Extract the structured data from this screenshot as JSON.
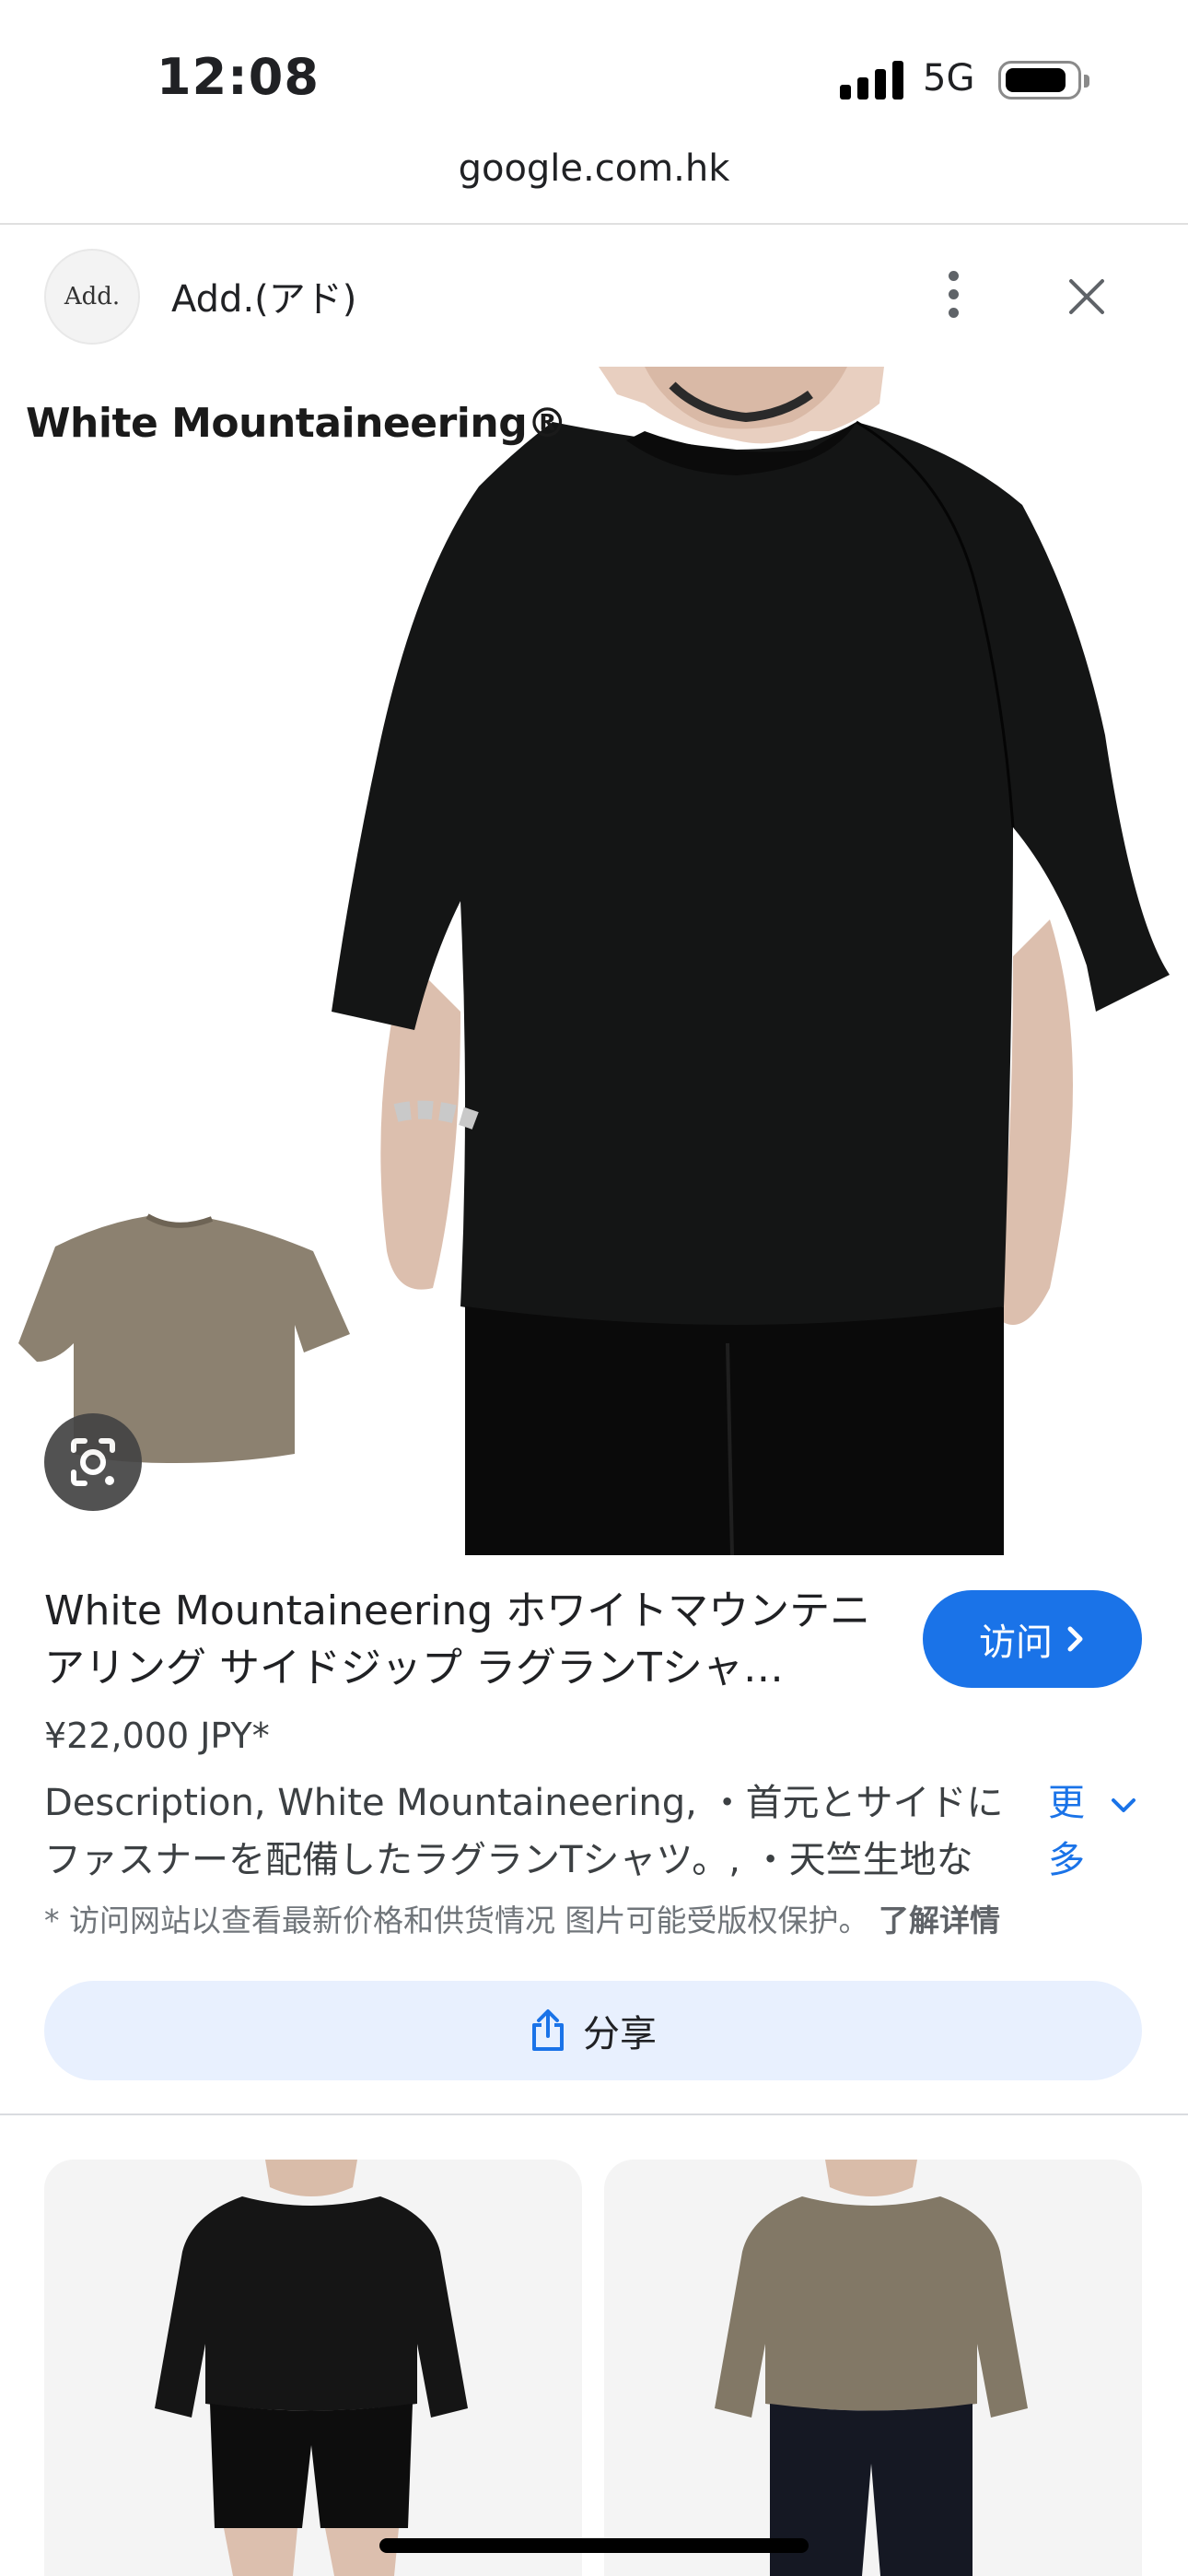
{
  "status_bar": {
    "time": "12:08",
    "network": "5G"
  },
  "browser": {
    "url": "google.com.hk"
  },
  "header": {
    "site_logo_text": "Add.",
    "site_name": "Add.(アド)",
    "more_icon": "more-vert-icon",
    "close_icon": "close-icon"
  },
  "hero_image": {
    "brand_logo": "White Mountaineering®",
    "lens_icon": "google-lens-icon"
  },
  "product": {
    "title": "White Mountaineering ホワイトマウンテニアリング サイドジップ ラグランTシャ…",
    "price": "¥22,000 JPY*",
    "description": "Description, White Mountaineering, ・首元とサイドにファスナーを配備したラグランTシャツ。, ・天竺生地な",
    "more_label": "更多",
    "disclaimer": "* 访问网站以查看最新价格和供货情况 图片可能受版权保护。",
    "learn_more": "了解详情"
  },
  "actions": {
    "visit_label": "访问",
    "share_label": "分享"
  },
  "colors": {
    "accent": "#1a73e8",
    "share_bg": "#e8f0fe"
  }
}
